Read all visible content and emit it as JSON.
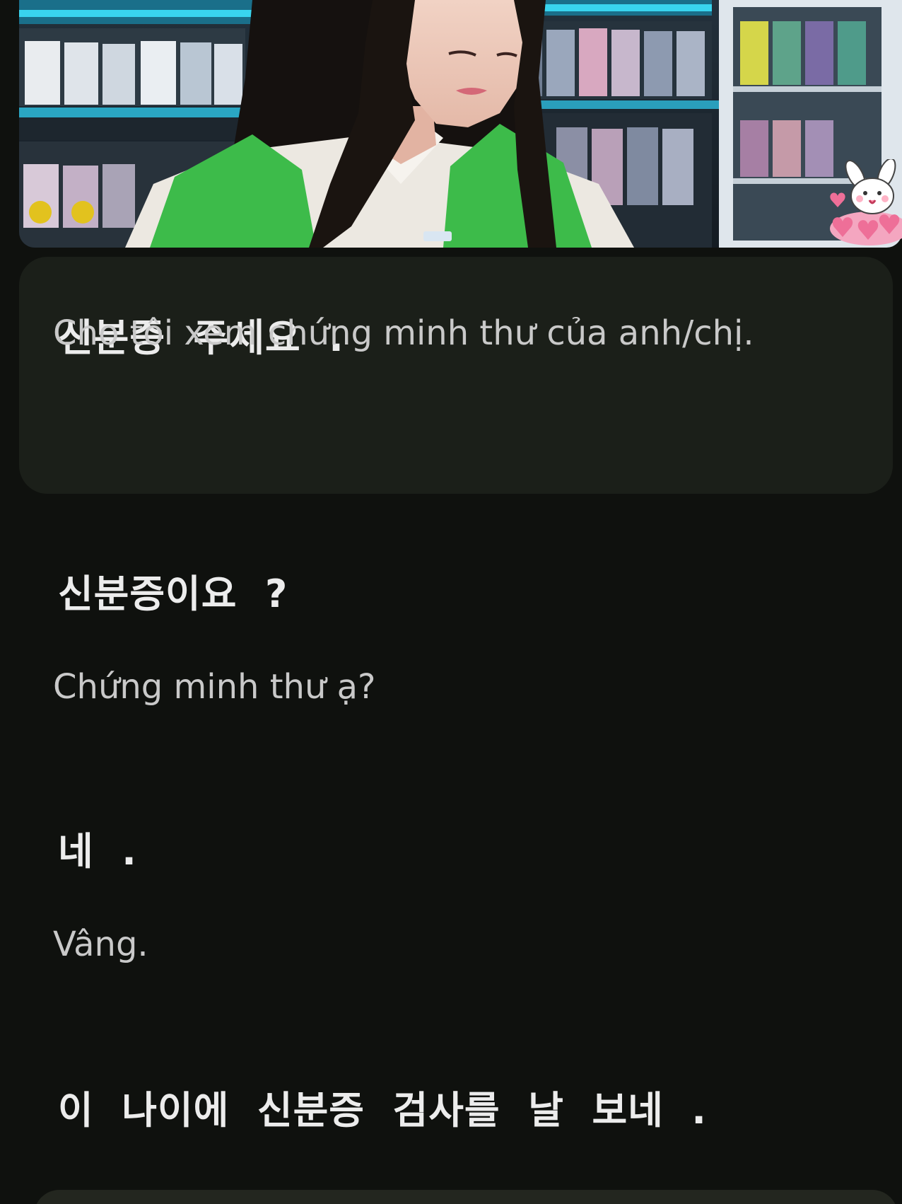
{
  "subtitles": {
    "lines": [
      {
        "ko": "신분증  주세요  .",
        "vi": "Cho tôi xem chứng minh thư của anh/chị."
      },
      {
        "ko": "신분증이요  ?",
        "vi": "Chứng minh thư ạ?"
      },
      {
        "ko": "네  .",
        "vi": "Vâng."
      },
      {
        "ko": "이  나이에  신분증  검사를  날  보네  .",
        "vi": ""
      }
    ]
  },
  "colors": {
    "background": "#0f110e",
    "active_card": "#1b1f19",
    "korean_text": "#ececec",
    "vietnamese_text": "#c9c9c9",
    "vest_green": "#3dbb4a"
  },
  "icons": {
    "sticker": "bunny-hearts-sticker-icon"
  }
}
